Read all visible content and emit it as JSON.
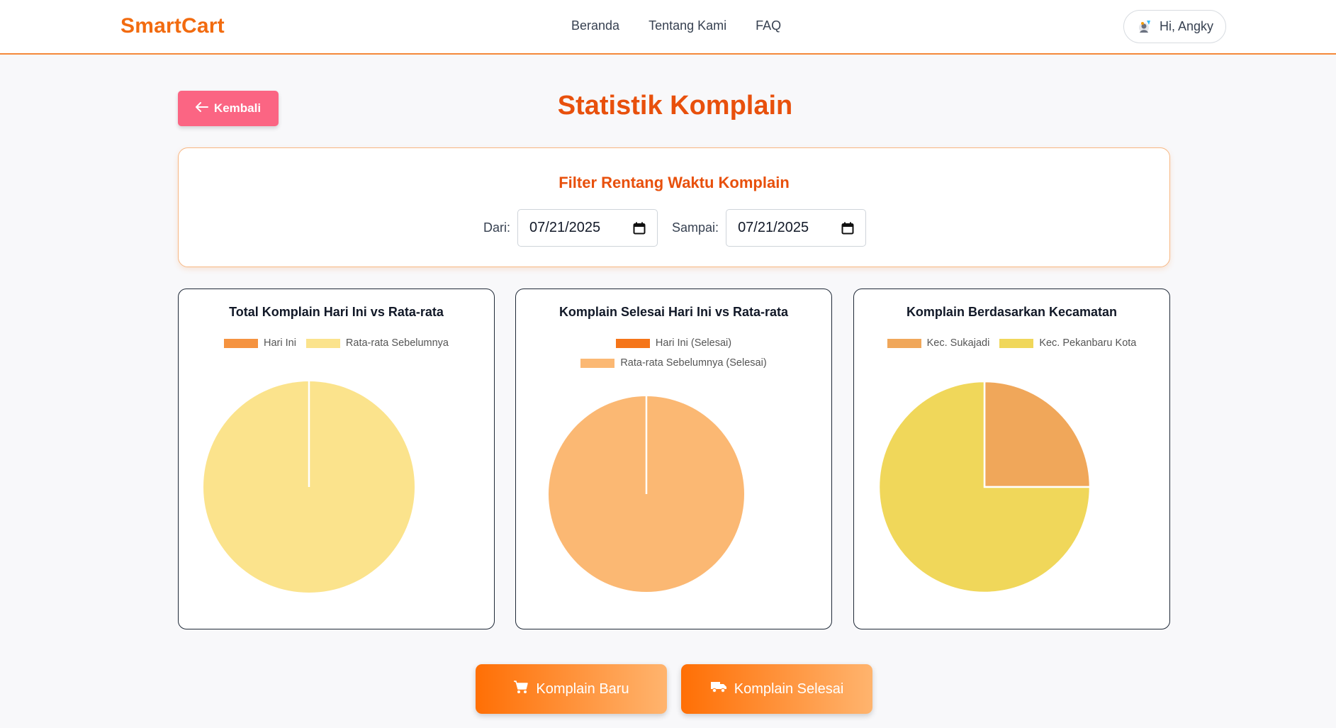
{
  "brand": "SmartCart",
  "nav": {
    "links": [
      "Beranda",
      "Tentang Kami",
      "FAQ"
    ],
    "user_greeting": "Hi, Angky"
  },
  "header": {
    "back_label": "Kembali",
    "title": "Statistik Komplain"
  },
  "filter": {
    "title": "Filter Rentang Waktu Komplain",
    "from_label": "Dari:",
    "from_value": "07/21/2025",
    "to_label": "Sampai:",
    "to_value": "07/21/2025"
  },
  "chart_data": [
    {
      "type": "pie",
      "title": "Total Komplain Hari Ini vs Rata-rata",
      "categories": [
        "Hari Ini",
        "Rata-rata Sebelumnya"
      ],
      "values": [
        0,
        1
      ],
      "colors": [
        "#f59340",
        "#fbe38c"
      ]
    },
    {
      "type": "pie",
      "title": "Komplain Selesai Hari Ini vs Rata-rata",
      "categories": [
        "Hari Ini (Selesai)",
        "Rata-rata Sebelumnya (Selesai)"
      ],
      "values": [
        0,
        1
      ],
      "colors": [
        "#f57519",
        "#fbb873"
      ]
    },
    {
      "type": "pie",
      "title": "Komplain Berdasarkan Kecamatan",
      "categories": [
        "Kec. Sukajadi",
        "Kec. Pekanbaru Kota"
      ],
      "values": [
        1,
        3
      ],
      "colors": [
        "#f0a75a",
        "#f0d75a"
      ]
    }
  ],
  "actions": {
    "new_label": "Komplain Baru",
    "done_label": "Komplain Selesai"
  },
  "colors": {
    "brand": "#f26b0f",
    "title": "#e8500c",
    "back_button": "#fb6583"
  }
}
